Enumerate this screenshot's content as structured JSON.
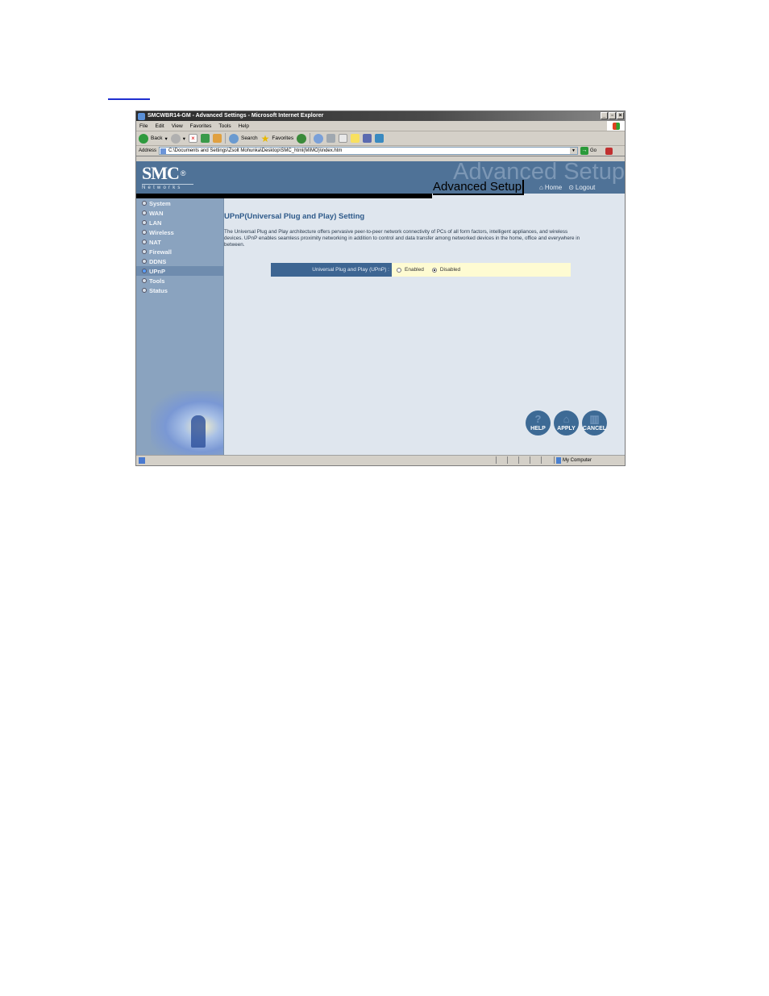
{
  "window": {
    "title": "SMCWBR14-GM - Advanced Settings - Microsoft Internet Explorer",
    "controls": [
      "minimize",
      "restore",
      "close"
    ]
  },
  "menubar": {
    "items": [
      "File",
      "Edit",
      "View",
      "Favorites",
      "Tools",
      "Help"
    ]
  },
  "toolbar": {
    "back_label": "Back",
    "search_label": "Search",
    "favorites_label": "Favorites"
  },
  "addressbar": {
    "label": "Address",
    "value": "C:\\Documents and Settings\\Zsolt Mohunka\\Desktop\\SMC_html(MIMO)\\index.htm",
    "go_label": "Go"
  },
  "banner": {
    "logo": "SMC",
    "logo_mark": "®",
    "logo_sub": "Networks",
    "ghost_title": "Advanced Setup",
    "title": "Advanced Setup",
    "home_label": "Home",
    "logout_label": "Logout"
  },
  "sidebar": {
    "items": [
      {
        "label": "System",
        "active": false
      },
      {
        "label": "WAN",
        "active": false
      },
      {
        "label": "LAN",
        "active": false
      },
      {
        "label": "Wireless",
        "active": false
      },
      {
        "label": "NAT",
        "active": false
      },
      {
        "label": "Firewall",
        "active": false
      },
      {
        "label": "DDNS",
        "active": false
      },
      {
        "label": "UPnP",
        "active": true
      },
      {
        "label": "Tools",
        "active": false
      },
      {
        "label": "Status",
        "active": false
      }
    ]
  },
  "content": {
    "heading": "UPnP(Universal Plug and Play) Setting",
    "description": "The Universal Plug and Play architecture offers pervasive peer-to-peer network connectivity of PCs of all form factors, intelligent appliances, and wireless devices. UPnP enables seamless proximity networking in addition to control and data transfer among networked devices in the home, office and everywhere in between.",
    "setting_label": "Universal Plug and Play (UPnP) :",
    "options": [
      {
        "label": "Enabled",
        "selected": false
      },
      {
        "label": "Disabled",
        "selected": true
      }
    ]
  },
  "actions": {
    "help": "HELP",
    "apply": "APPLY",
    "cancel": "CANCEL"
  },
  "statusbar": {
    "zone": "My Computer"
  }
}
